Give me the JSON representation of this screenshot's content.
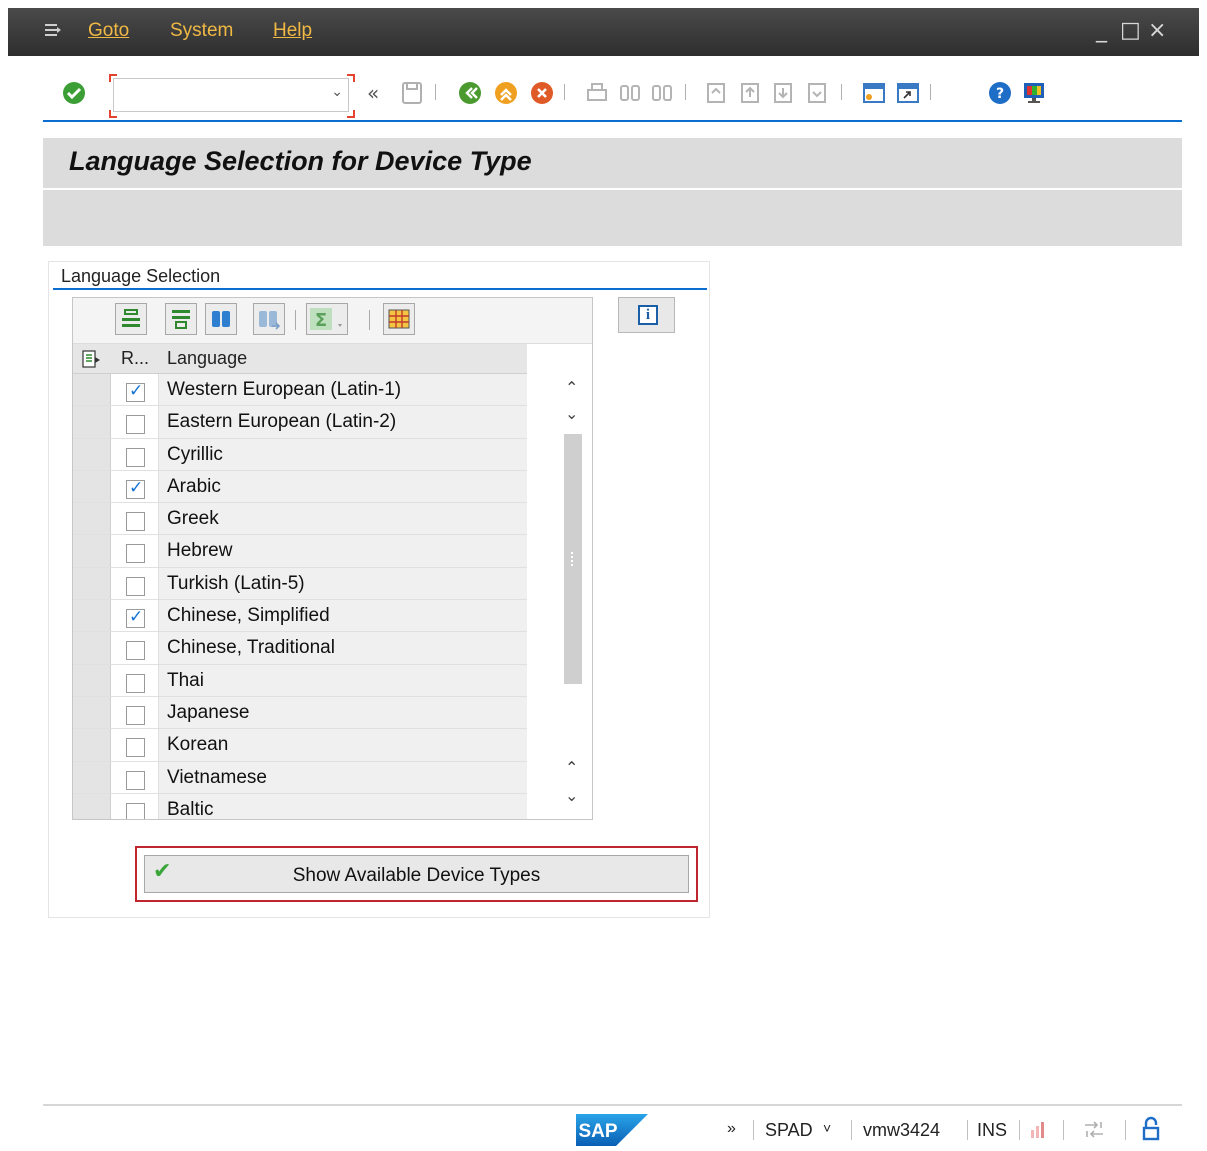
{
  "menubar": {
    "items": [
      "Goto",
      "System",
      "Help"
    ],
    "controls": [
      "_",
      "□",
      "×"
    ]
  },
  "toolbar": {
    "command_value": "",
    "nav_label": "«",
    "icons": [
      "enter-icon",
      "save-icon",
      "back-icon",
      "exit-icon",
      "cancel-icon",
      "print-icon",
      "find-icon",
      "find-next-icon",
      "first-page-icon",
      "previous-page-icon",
      "next-page-icon",
      "last-page-icon",
      "create-session-icon",
      "shortcut-icon",
      "help-icon",
      "layout-icon"
    ]
  },
  "title": "Language Selection for Device Type",
  "group": {
    "title": "Language Selection"
  },
  "table": {
    "toolbar_icons": [
      "select-all-icon",
      "deselect-all-icon",
      "find-icon",
      "find-next-icon",
      "sum-icon",
      "layout-icon"
    ],
    "headers": {
      "r": "R...",
      "language": "Language"
    },
    "rows": [
      {
        "checked": true,
        "language": "Western European (Latin-1)"
      },
      {
        "checked": false,
        "language": "Eastern European (Latin-2)"
      },
      {
        "checked": false,
        "language": "Cyrillic"
      },
      {
        "checked": true,
        "language": "Arabic"
      },
      {
        "checked": false,
        "language": "Greek"
      },
      {
        "checked": false,
        "language": "Hebrew"
      },
      {
        "checked": false,
        "language": "Turkish (Latin-5)"
      },
      {
        "checked": true,
        "language": "Chinese, Simplified"
      },
      {
        "checked": false,
        "language": "Chinese, Traditional"
      },
      {
        "checked": false,
        "language": "Thai"
      },
      {
        "checked": false,
        "language": "Japanese"
      },
      {
        "checked": false,
        "language": "Korean"
      },
      {
        "checked": false,
        "language": "Vietnamese"
      },
      {
        "checked": false,
        "language": "Baltic"
      }
    ]
  },
  "action": {
    "label": "Show Available Device Types"
  },
  "status": {
    "logo": "SAP",
    "expand": "»",
    "transaction": "SPAD",
    "dropdown": "˅",
    "server": "vmw3424",
    "mode": "INS"
  }
}
